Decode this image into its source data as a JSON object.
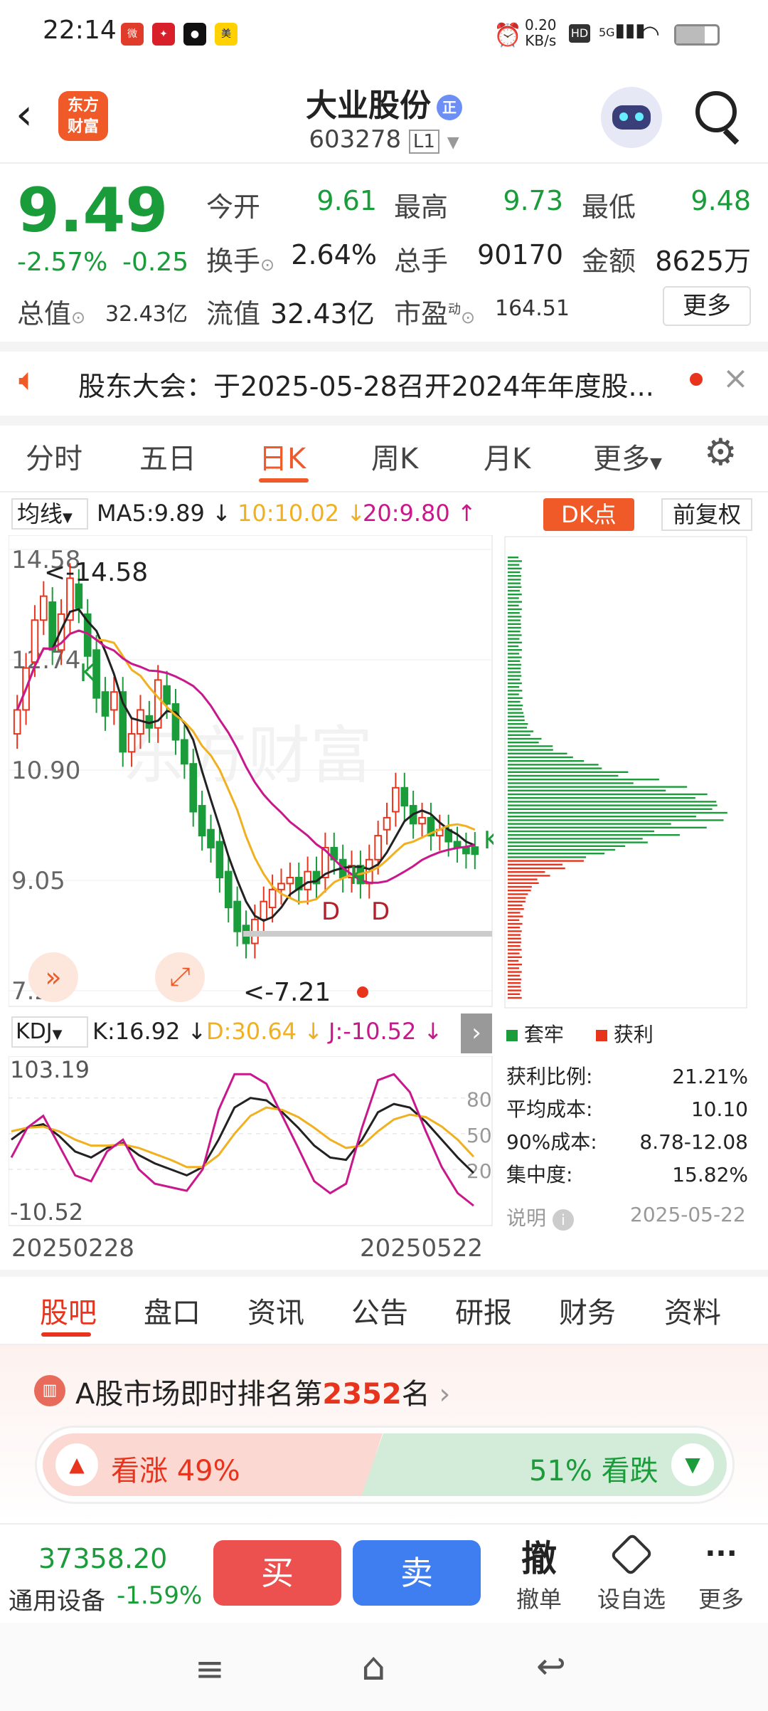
{
  "status_bar": {
    "time": "22:14",
    "net_speed": "0.20",
    "net_unit": "KB/s",
    "icons": [
      "weibo-icon",
      "app-icon-2",
      "app-icon-3",
      "meituan-icon",
      "alarm-icon",
      "hd-icon",
      "signal-icon",
      "wifi-icon",
      "battery-icon"
    ]
  },
  "header": {
    "logo": "东方\n财富",
    "stock_name": "大业股份",
    "stock_code": "603278",
    "level": "L1"
  },
  "quote": {
    "price": "9.49",
    "change_pct": "-2.57%",
    "change": "-0.25",
    "open_label": "今开",
    "open": "9.61",
    "high_label": "最高",
    "high": "9.73",
    "low_label": "最低",
    "low": "9.48",
    "turnover_label": "换手",
    "turnover": "2.64%",
    "volume_label": "总手",
    "volume": "90170",
    "amount_label": "金额",
    "amount": "8625万",
    "mktcap_label": "总值",
    "mktcap": "32.43亿",
    "float_label": "流值",
    "float": "32.43亿",
    "pe_label": "市盈",
    "pe_sup": "动",
    "pe": "164.51",
    "more": "更多"
  },
  "notice": {
    "text": "股东大会：于2025-05-28召开2024年年度股..."
  },
  "k_tabs": [
    "分时",
    "五日",
    "日K",
    "周K",
    "月K",
    "更多"
  ],
  "k_active": "日K",
  "ma_bar": {
    "selector": "均线",
    "ma5": "MA5:9.89 ↓",
    "ma10": "10:10.02 ↓",
    "ma20": "20:9.80 ↑",
    "dk": "DK点",
    "adjust": "前复权"
  },
  "chart_data": [
    {
      "type": "candlestick",
      "yticks": [
        "14.58",
        "12.74",
        "10.90",
        "9.05",
        "7.21"
      ],
      "max_label": "<-14.58",
      "min_label": "<-7.21",
      "ylim": [
        7.21,
        14.58
      ],
      "x_start": "20250228",
      "x_end": "20250522",
      "series": [
        {
          "name": "MA5",
          "value": 9.89
        },
        {
          "name": "MA10",
          "value": 10.02
        },
        {
          "name": "MA20",
          "value": 9.8
        }
      ],
      "closes": [
        11.9,
        12.6,
        13.4,
        13.8,
        12.9,
        13.5,
        14.1,
        13.6,
        12.8,
        12.1,
        11.8,
        12.2,
        11.2,
        11.5,
        11.9,
        11.6,
        12.4,
        12.0,
        11.4,
        11.0,
        10.2,
        9.8,
        9.6,
        9.1,
        8.6,
        8.2,
        8.0,
        8.4,
        8.7,
        8.9,
        9.0,
        9.1,
        8.9,
        9.2,
        9.0,
        9.6,
        9.4,
        9.1,
        9.3,
        9.0,
        9.4,
        9.8,
        10.1,
        10.6,
        10.3,
        10.0,
        10.1,
        9.8,
        9.9,
        9.7,
        9.6,
        9.5,
        9.49
      ],
      "opens": [
        11.5,
        11.9,
        12.7,
        13.4,
        13.7,
        12.9,
        13.4,
        14.0,
        13.5,
        12.9,
        12.2,
        11.9,
        12.2,
        11.2,
        11.5,
        11.8,
        11.6,
        12.3,
        12.0,
        11.4,
        11.0,
        10.3,
        9.9,
        9.7,
        9.2,
        8.7,
        8.3,
        8.0,
        8.4,
        8.6,
        8.9,
        9.0,
        9.1,
        8.9,
        9.2,
        9.1,
        9.6,
        9.4,
        9.1,
        9.3,
        9.0,
        9.4,
        9.9,
        10.2,
        10.6,
        10.3,
        10.0,
        10.1,
        9.8,
        9.9,
        9.7,
        9.6,
        9.61
      ],
      "markers": [
        "K",
        "D",
        "D",
        "K",
        "K"
      ]
    },
    {
      "type": "line",
      "name": "KDJ",
      "k_label": "K:16.92 ↓",
      "d_label": "D:30.64 ↓",
      "j_label": "J:-10.52 ↓",
      "yticks_left": [
        "103.19",
        "-10.52"
      ],
      "yticks_right": [
        "80",
        "50",
        "20"
      ],
      "ylim": [
        -10.52,
        103.19
      ],
      "series": [
        {
          "name": "K",
          "values": [
            45,
            55,
            58,
            48,
            35,
            30,
            38,
            42,
            32,
            25,
            20,
            15,
            22,
            45,
            72,
            80,
            78,
            68,
            55,
            40,
            30,
            28,
            45,
            68,
            75,
            72,
            60,
            45,
            30,
            16.92
          ]
        },
        {
          "name": "D",
          "values": [
            52,
            55,
            56,
            52,
            45,
            40,
            40,
            41,
            38,
            33,
            28,
            22,
            22,
            32,
            50,
            65,
            72,
            70,
            64,
            55,
            45,
            38,
            40,
            52,
            62,
            66,
            64,
            56,
            45,
            30.64
          ]
        },
        {
          "name": "J",
          "values": [
            30,
            55,
            65,
            40,
            15,
            10,
            35,
            45,
            20,
            8,
            5,
            2,
            20,
            70,
            100,
            100,
            92,
            65,
            38,
            10,
            0,
            8,
            55,
            95,
            100,
            85,
            52,
            22,
            0,
            -10.52
          ]
        }
      ]
    },
    {
      "type": "bar",
      "name": "筹码分布",
      "legend": [
        "套牢",
        "获利"
      ],
      "stats": [
        {
          "label": "获利比例:",
          "value": "21.21%"
        },
        {
          "label": "平均成本:",
          "value": "10.10"
        },
        {
          "label": "90%成本:",
          "value": "8.78-12.08"
        },
        {
          "label": "集中度:",
          "value": "15.82%"
        }
      ],
      "note_label": "说明",
      "date": "2025-05-22"
    }
  ],
  "bottom_tabs": [
    "股吧",
    "盘口",
    "资讯",
    "公告",
    "研报",
    "财务",
    "资料"
  ],
  "bottom_active": "股吧",
  "ranking": {
    "prefix": "A股市场即时排名第",
    "rank": "2352",
    "suffix": "名"
  },
  "sentiment": {
    "up_label": "看涨",
    "up_pct": "49%",
    "down_pct": "51%",
    "down_label": "看跌"
  },
  "footer": {
    "index_value": "37358.20",
    "sector": "通用设备",
    "sector_change": "-1.59%",
    "buy": "买",
    "sell": "卖",
    "cancel_big": "撤",
    "cancel": "撤单",
    "watch": "设自选",
    "more": "更多"
  },
  "colors": {
    "up": "#e8341c",
    "down": "#1a9c3a",
    "ma5": "#222222",
    "ma10": "#f0b020",
    "ma20": "#c8188c",
    "accent": "#f05a28"
  }
}
